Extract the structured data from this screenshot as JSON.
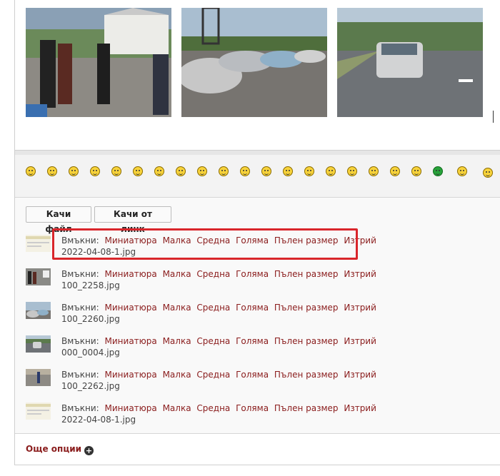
{
  "toolbar": {
    "smileys": [
      "smile-icon",
      "happy-icon",
      "sad-icon",
      "confused-icon",
      "surprised-icon",
      "eek-icon",
      "cool-icon",
      "razz-icon",
      "neutral-icon",
      "mad-icon",
      "evil-icon",
      "rolleyes-icon",
      "wink-icon",
      "exclaim-icon",
      "question-icon",
      "idea-icon",
      "arrow-icon",
      "glasses-icon",
      "twisted-icon",
      "green-grin-icon",
      "disguise-icon",
      "laugh-icon"
    ]
  },
  "buttons": {
    "upload_file": "Качи файл",
    "upload_link": "Качи от линк"
  },
  "attachments": {
    "insert_label": "Вмъкни:",
    "actions": [
      "Миниатюра",
      "Малка",
      "Средна",
      "Голяма",
      "Пълен размер",
      "Изтрий"
    ],
    "files": [
      {
        "name": "2022-04-08-1.jpg"
      },
      {
        "name": "100_2258.jpg"
      },
      {
        "name": "100_2260.jpg"
      },
      {
        "name": "000_0004.jpg"
      },
      {
        "name": "100_2262.jpg"
      },
      {
        "name": "2022-04-08-1.jpg"
      }
    ]
  },
  "more_options": "Още опции",
  "colors": {
    "link": "#8a1c1c",
    "highlight": "#d9262b"
  }
}
